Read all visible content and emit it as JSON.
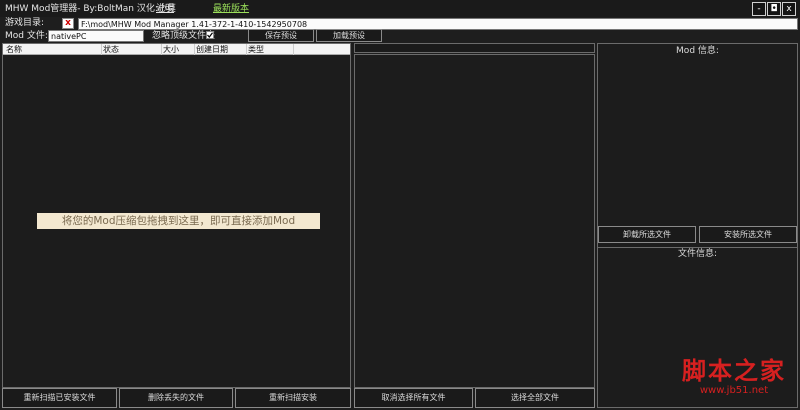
{
  "window": {
    "title": "MHW Mod管理器- By:BoltMan 汉化:小莫",
    "help_link": "说明",
    "latest_link": "最新版本",
    "minimize": "-",
    "restore": "◘",
    "close": "x"
  },
  "game_dir": {
    "label": "游戏目录:",
    "clear_button": "x",
    "path": "F:\\mod\\MHW Mod Manager 1.41-372-1-410-1542950708"
  },
  "mod_file": {
    "label": "Mod 文件:",
    "value": "nativePC",
    "ignore_label": "忽略顶级文件夹",
    "ignore_checked": true,
    "save_preset": "保存预设",
    "load_preset": "加载预设"
  },
  "mod_table": {
    "columns": [
      "名称",
      "状态",
      "大小",
      "创建日期",
      "类型"
    ],
    "drop_hint": "将您的Mod压缩包拖拽到这里，即可直接添加Mod"
  },
  "bottom_left": {
    "rescan_installed": "重新扫描已安装文件",
    "delete_missing": "删除丢失的文件",
    "rescan_install": "重新扫描安装"
  },
  "bottom_middle": {
    "deselect_all": "取消选择所有文件",
    "select_all": "选择全部文件"
  },
  "right_panel": {
    "mod_info_title": "Mod 信息:",
    "uninstall_selected": "卸载所选文件",
    "install_selected": "安装所选文件",
    "file_info_title": "文件信息:"
  },
  "watermark": {
    "line1": "脚本之家",
    "line2": "www.jb51.net"
  }
}
